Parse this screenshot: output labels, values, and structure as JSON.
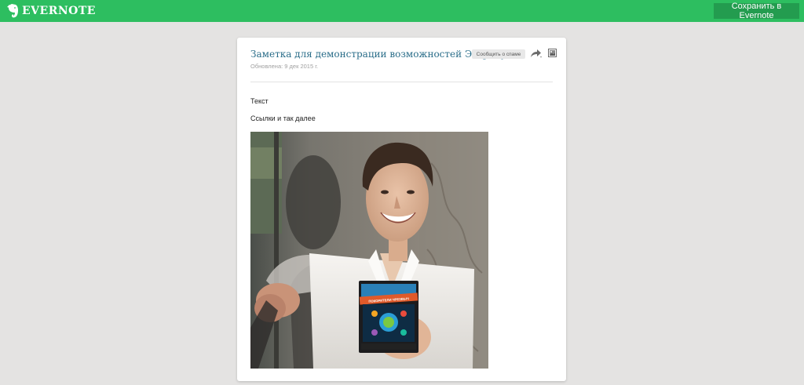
{
  "header": {
    "logo_text": "EVERNOTE",
    "logo_icon": "elephant-icon",
    "save_button_label": "Сохранить в Evernote",
    "brand_color": "#2dbe60"
  },
  "note": {
    "title": "Заметка для демонстрации возможностей Эверноут",
    "updated": "Обновлена: 9 дек 2015 г.",
    "report_spam_label": "Сообщить о спаме",
    "share_icon": "share-arrow-icon",
    "image_icon": "image-icon",
    "content": {
      "paragraph_1": "Текст",
      "paragraph_2": "Ссылки и так далее"
    },
    "photo": {
      "dvd_title": "ПОКОРИТЕЛИ ЧРЕЗВЫЧ"
    }
  }
}
